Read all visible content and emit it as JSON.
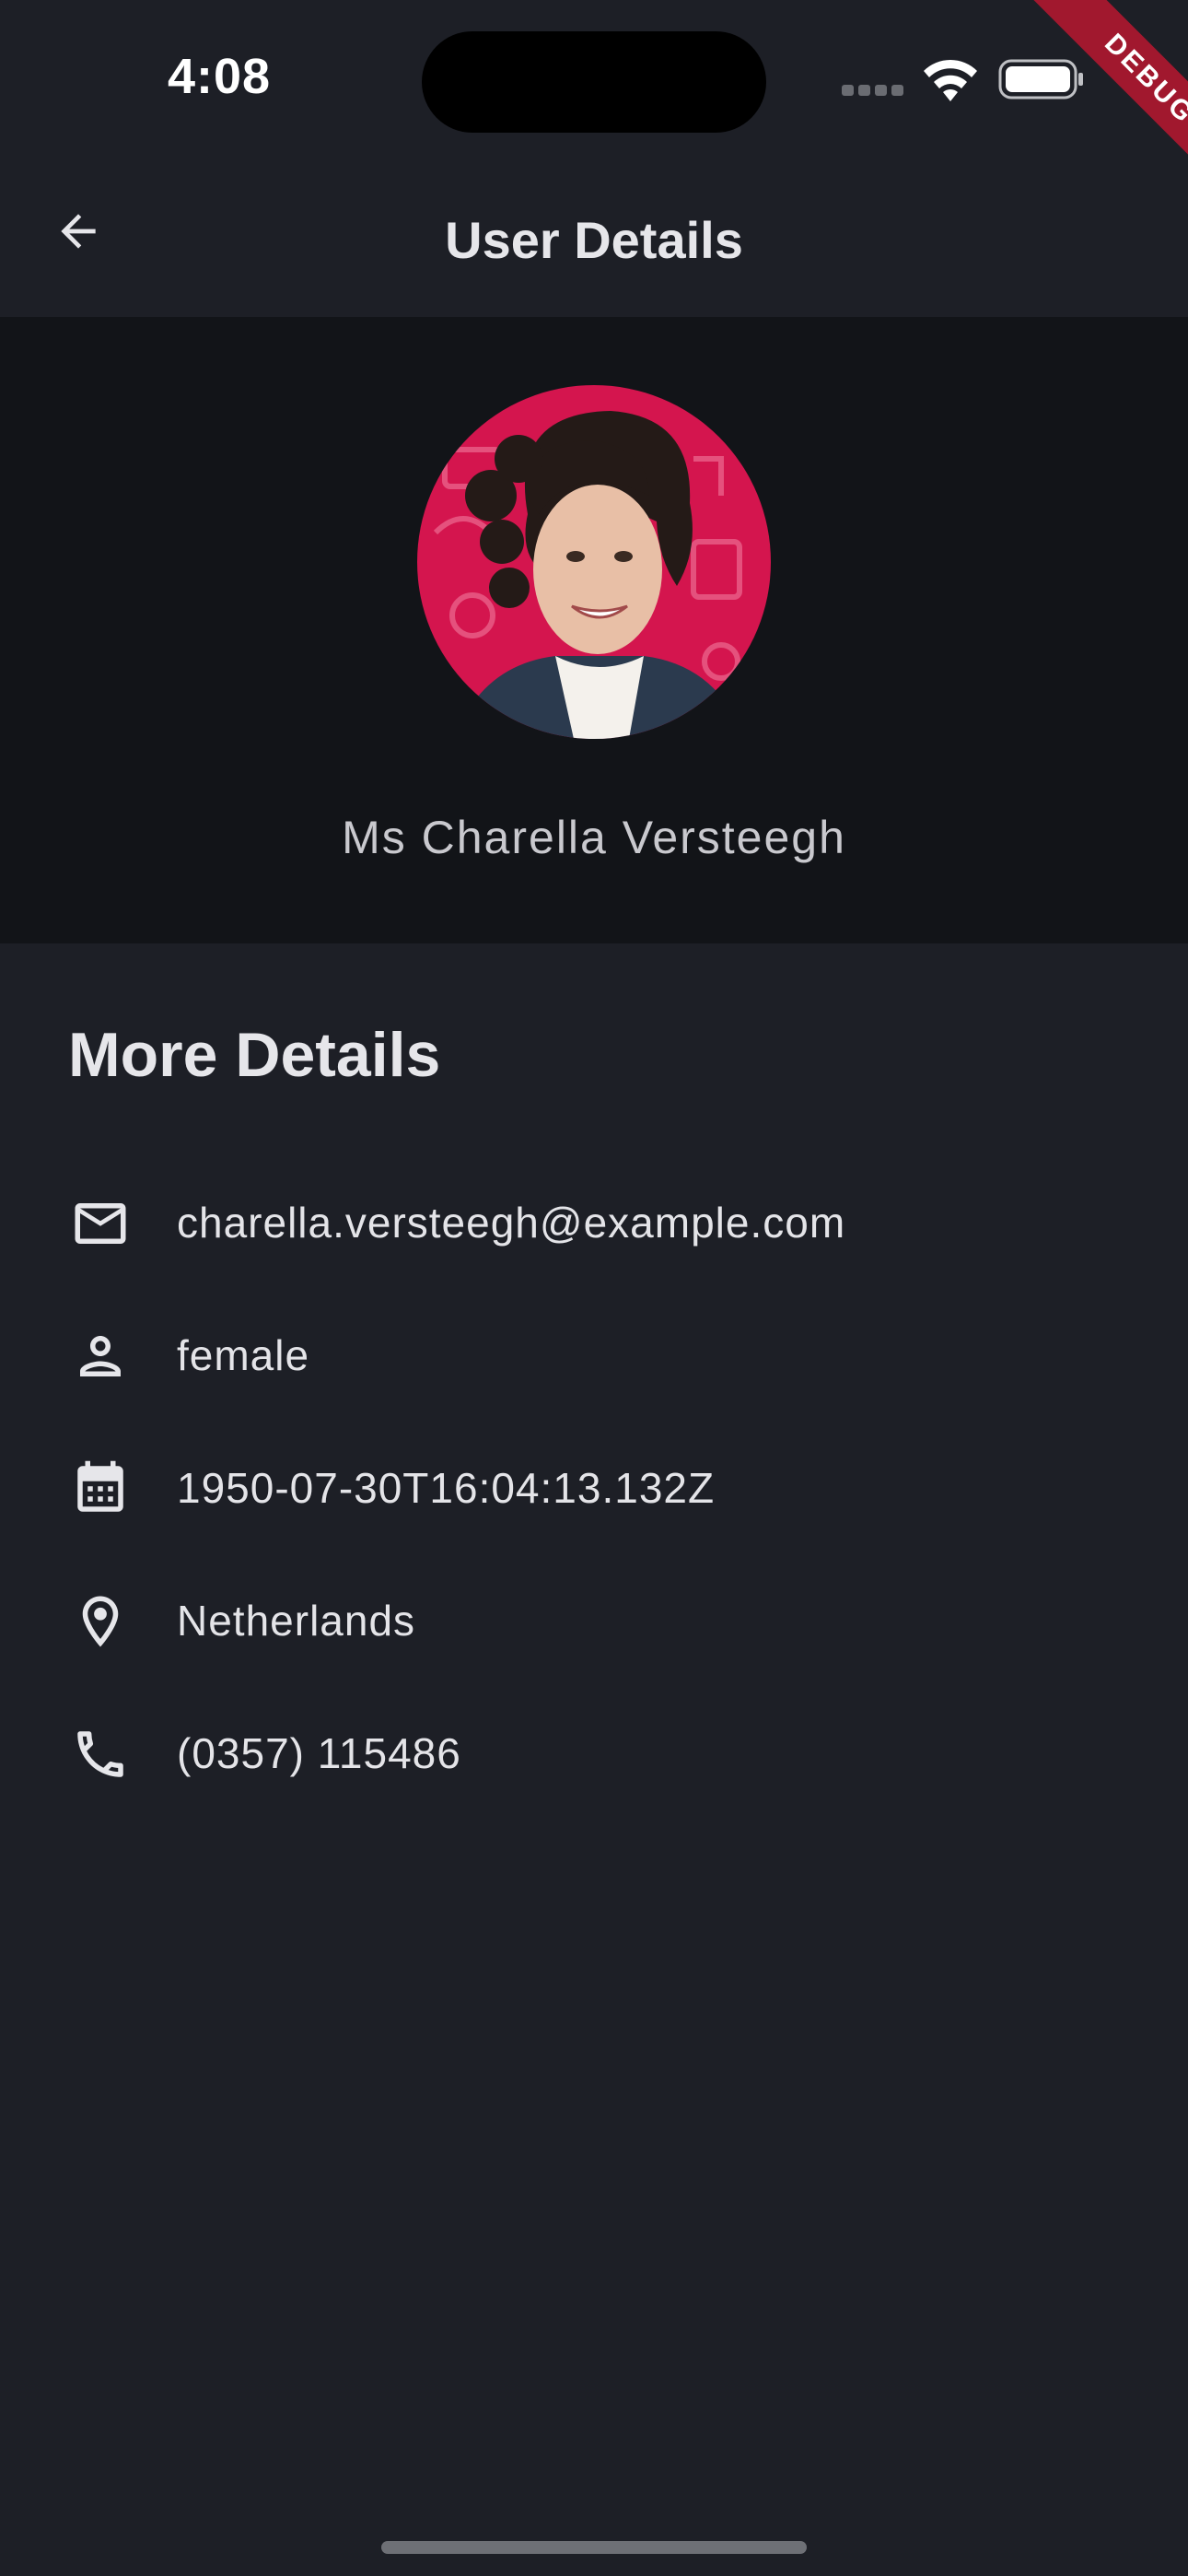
{
  "status_bar": {
    "time": "4:08",
    "icons": [
      "cellular-signal-icon",
      "wifi-icon",
      "battery-icon"
    ]
  },
  "debug_banner": {
    "label": "DEBUG",
    "color": "#a1182e"
  },
  "app_bar": {
    "title": "User Details",
    "back_icon": "arrow-back-icon"
  },
  "profile": {
    "name": "Ms Charella Versteegh",
    "avatar_background": "#d4154e"
  },
  "details": {
    "title": "More Details",
    "items": [
      {
        "icon": "mail-icon",
        "value": "charella.versteegh@example.com"
      },
      {
        "icon": "person-icon",
        "value": "female"
      },
      {
        "icon": "calendar-icon",
        "value": "1950-07-30T16:04:13.132Z"
      },
      {
        "icon": "location-pin-icon",
        "value": "Netherlands"
      },
      {
        "icon": "phone-icon",
        "value": "(0357) 115486"
      }
    ]
  },
  "colors": {
    "background": "#1d1f26",
    "header_panel": "#121418",
    "text": "#e4e4e8"
  }
}
